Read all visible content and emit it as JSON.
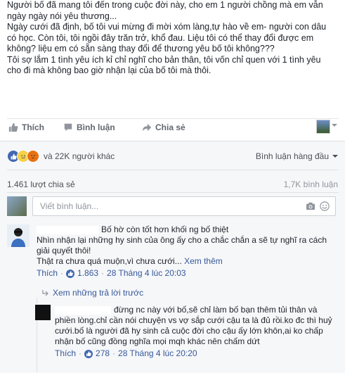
{
  "post": {
    "paragraphs": [
      "Người bố đã mang tôi đến trong cuộc đời này, cho em 1 người chồng mà em vẫn ngày ngày nói yêu thương...",
      "Ngày cưới đã định, bố tôi vui mừng đi mời xóm làng,tự hào về em- người con dâu có học. Còn tôi, tôi ngồi đây trăn trở, khổ đau. Liệu tôi có thể thay đổi được em không? liệu em có sẵn sàng thay đổi để thương yêu bố tôi không???",
      "Tôi sợ lắm 1 tình yêu ích kỉ chỉ nghĩ cho bản thân, tôi vốn chỉ quen với 1 tình yêu cho đi mà không bao giờ nhận lại của bố tôi mà thôi."
    ]
  },
  "actions": {
    "like": "Thích",
    "comment": "Bình luận",
    "share": "Chia sẻ"
  },
  "reactions": {
    "summary": "và 22K người khác",
    "sort_label": "Bình luận hàng đầu"
  },
  "stats": {
    "shares": "1.461 lượt chia sẻ",
    "comments": "1,7K bình luận"
  },
  "composer": {
    "placeholder": "Viết bình luận..."
  },
  "comments": [
    {
      "text": "Bố hờ còn tốt hơn khối ng bố thiệt",
      "text2": "Nhìn nhận lại những hy sinh của ông ấy cho a chắc chắn a sẽ tự nghĩ ra cách giải quyết thôi!",
      "text3": "Thật ra chưa quá muộn,vì chưa cưới...",
      "more": "Xem thêm",
      "like": "Thích",
      "likes": "1.863",
      "time": "28 Tháng 4 lúc 20:03"
    }
  ],
  "view_replies": "Xem những trả lời trước",
  "reply": {
    "text": "đừng nc này với bố,sẽ chỉ làm bố bạn thêm tủi thân và phiền lòng.chỉ cần nói chuyện vs vợ sắp cưới cậu ta là đủ rồi.ko đc thì huỷ cưới.bố là người đã hy sinh cả cuộc đời cho cậu ấy lớn khôn,ai ko chấp nhận bố cũng đồng nghĩa mọi mqh khác nên chấm dứt",
    "like": "Thích",
    "likes": "278",
    "time": "28 Tháng 4 lúc 20:20"
  }
}
